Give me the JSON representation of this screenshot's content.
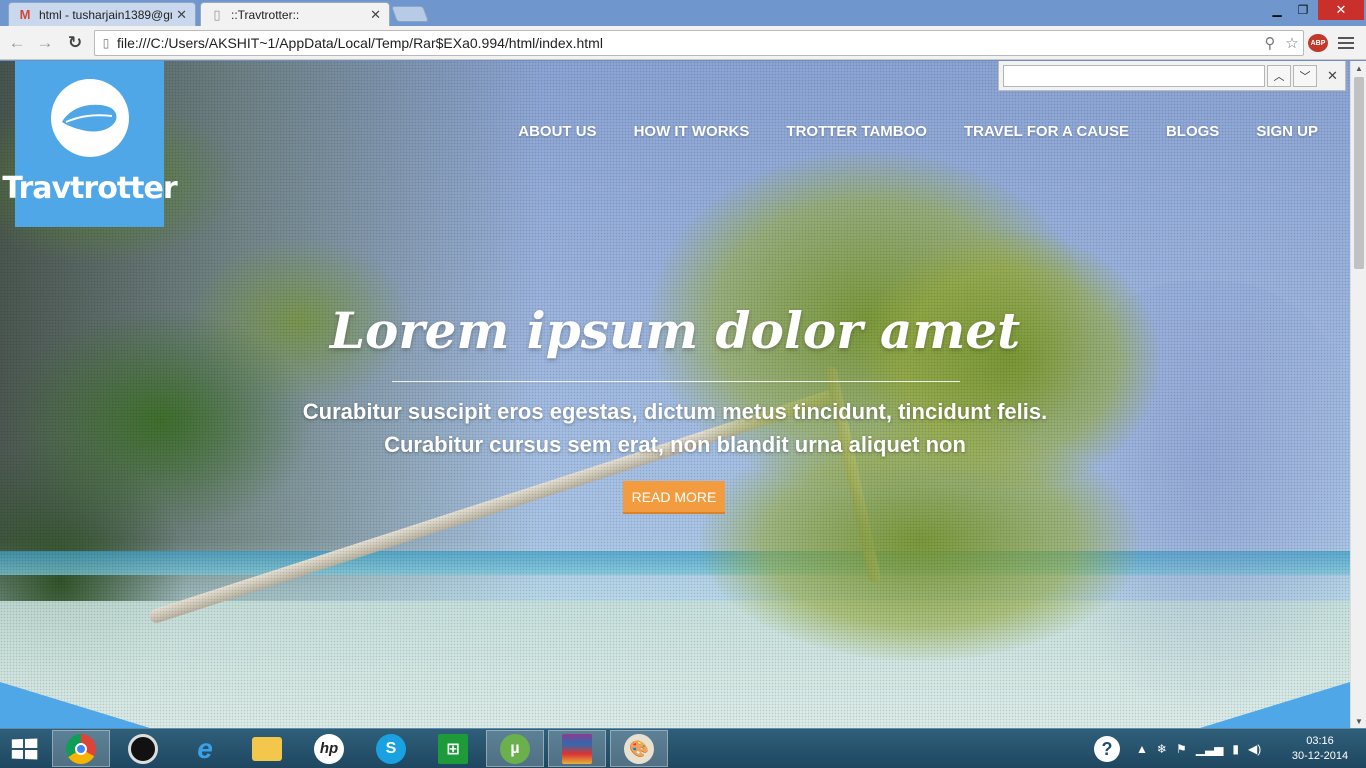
{
  "browser": {
    "tabs": [
      {
        "title": "html - tusharjain1389@gm",
        "icon": "gmail-icon"
      },
      {
        "title": "::Travtrotter::",
        "icon": "page-icon"
      }
    ],
    "url": "file:///C:/Users/AKSHIT~1/AppData/Local/Temp/Rar$EXa0.994/html/index.html",
    "extension_badge": "ABP",
    "find_query": ""
  },
  "site": {
    "logo_text": "Travtrotter",
    "nav": [
      "ABOUT US",
      "HOW IT WORKS",
      "TROTTER TAMBOO",
      "TRAVEL FOR A CAUSE",
      "BLOGS",
      "SIGN UP"
    ],
    "hero_title": "Lorem ipsum dolor amet",
    "hero_line1": "Curabitur suscipit eros egestas, dictum metus tincidunt, tincidunt felis.",
    "hero_line2": "Curabitur cursus sem erat, non blandit urna aliquet non",
    "cta": "READ MORE",
    "accent_color": "#4fa7e8",
    "cta_color": "#f39c3f"
  },
  "taskbar": {
    "apps": [
      "chrome-icon",
      "media-icon",
      "ie-icon",
      "explorer-icon",
      "hp-icon",
      "skype-icon",
      "store-icon",
      "utorrent-icon",
      "winrar-icon",
      "paint-icon"
    ],
    "time": "03:16",
    "date": "30-12-2014"
  }
}
